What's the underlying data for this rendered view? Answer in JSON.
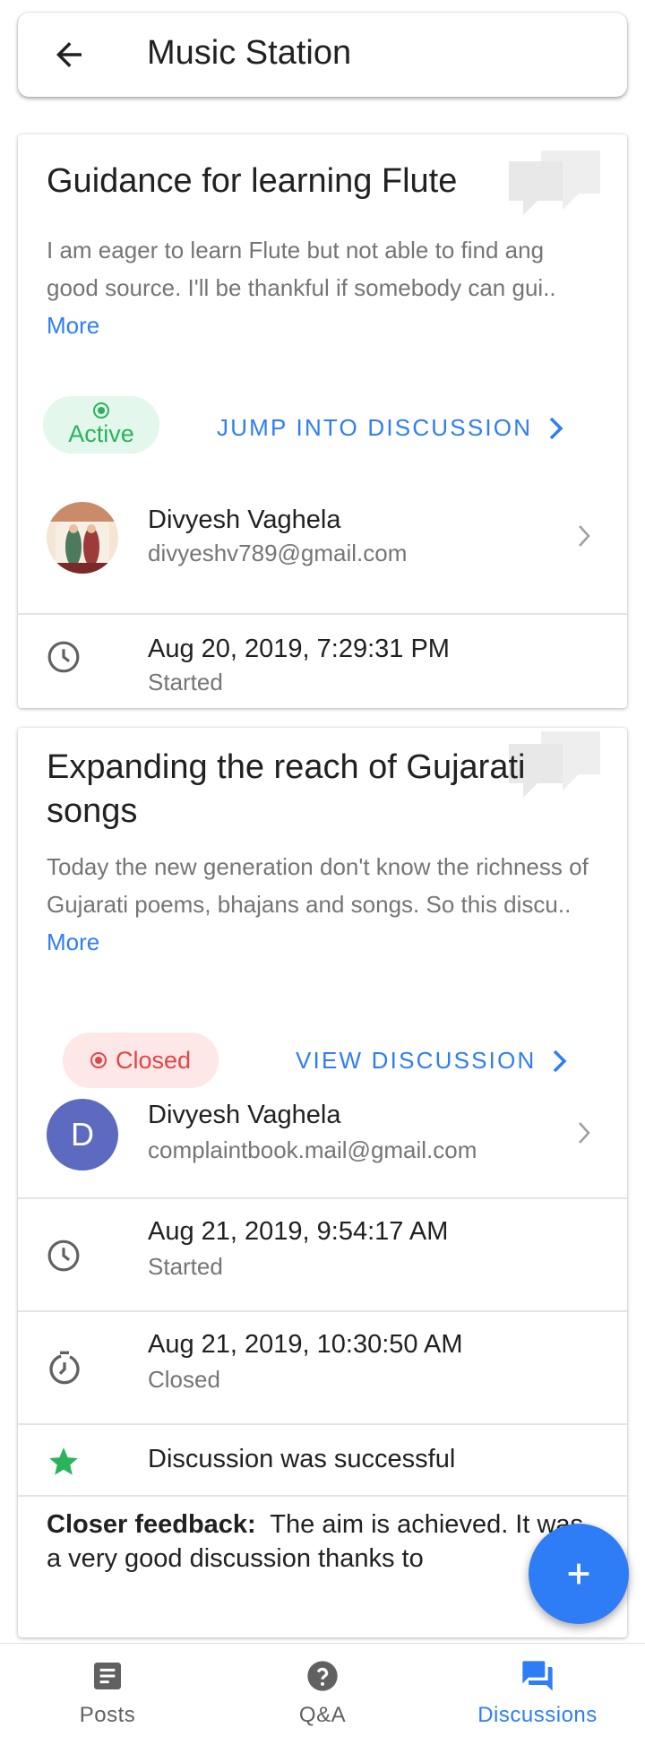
{
  "header": {
    "title": "Music Station",
    "back_icon": "arrow-back-icon"
  },
  "discussions": [
    {
      "title": "Guidance for learning Flute",
      "description": "I am eager to learn Flute but not able to find ang good source. I'll be thankful if somebody can gui..",
      "more_label": "More",
      "status": "Active",
      "status_color": "#2bb35c",
      "action_label": "JUMP INTO DISCUSSION",
      "author_name": "Divyesh Vaghela",
      "author_email": "divyeshv789@gmail.com",
      "started_time": "Aug 20, 2019, 7:29:31 PM",
      "started_label": "Started"
    },
    {
      "title": "Expanding the reach of Gujarati songs",
      "description": "Today the new generation don't know the richness of Gujarati poems, bhajans and songs. So this discu..",
      "more_label": "More",
      "status": "Closed",
      "status_color": "#e24545",
      "action_label": "VIEW DISCUSSION",
      "author_name": "Divyesh Vaghela",
      "author_initial": "D",
      "author_email": "complaintbook.mail@gmail.com",
      "started_time": "Aug 21, 2019, 9:54:17 AM",
      "started_label": "Started",
      "closed_time": "Aug 21, 2019, 10:30:50 AM",
      "closed_label": "Closed",
      "result": "Discussion was successful",
      "feedback_label": "Closer feedback:",
      "feedback_text": "The aim is achieved. It was a very good discussion thanks to"
    }
  ],
  "fab": {
    "icon": "plus-icon"
  },
  "bottom_nav": [
    {
      "label": "Posts",
      "icon": "post-icon",
      "active": false
    },
    {
      "label": "Q&A",
      "icon": "help-icon",
      "active": false
    },
    {
      "label": "Discussions",
      "icon": "forum-icon",
      "active": true
    }
  ],
  "colors": {
    "accent": "#2f7df6",
    "active": "#2bb35c",
    "closed": "#e24545",
    "avatar": "#5c6bc0"
  }
}
